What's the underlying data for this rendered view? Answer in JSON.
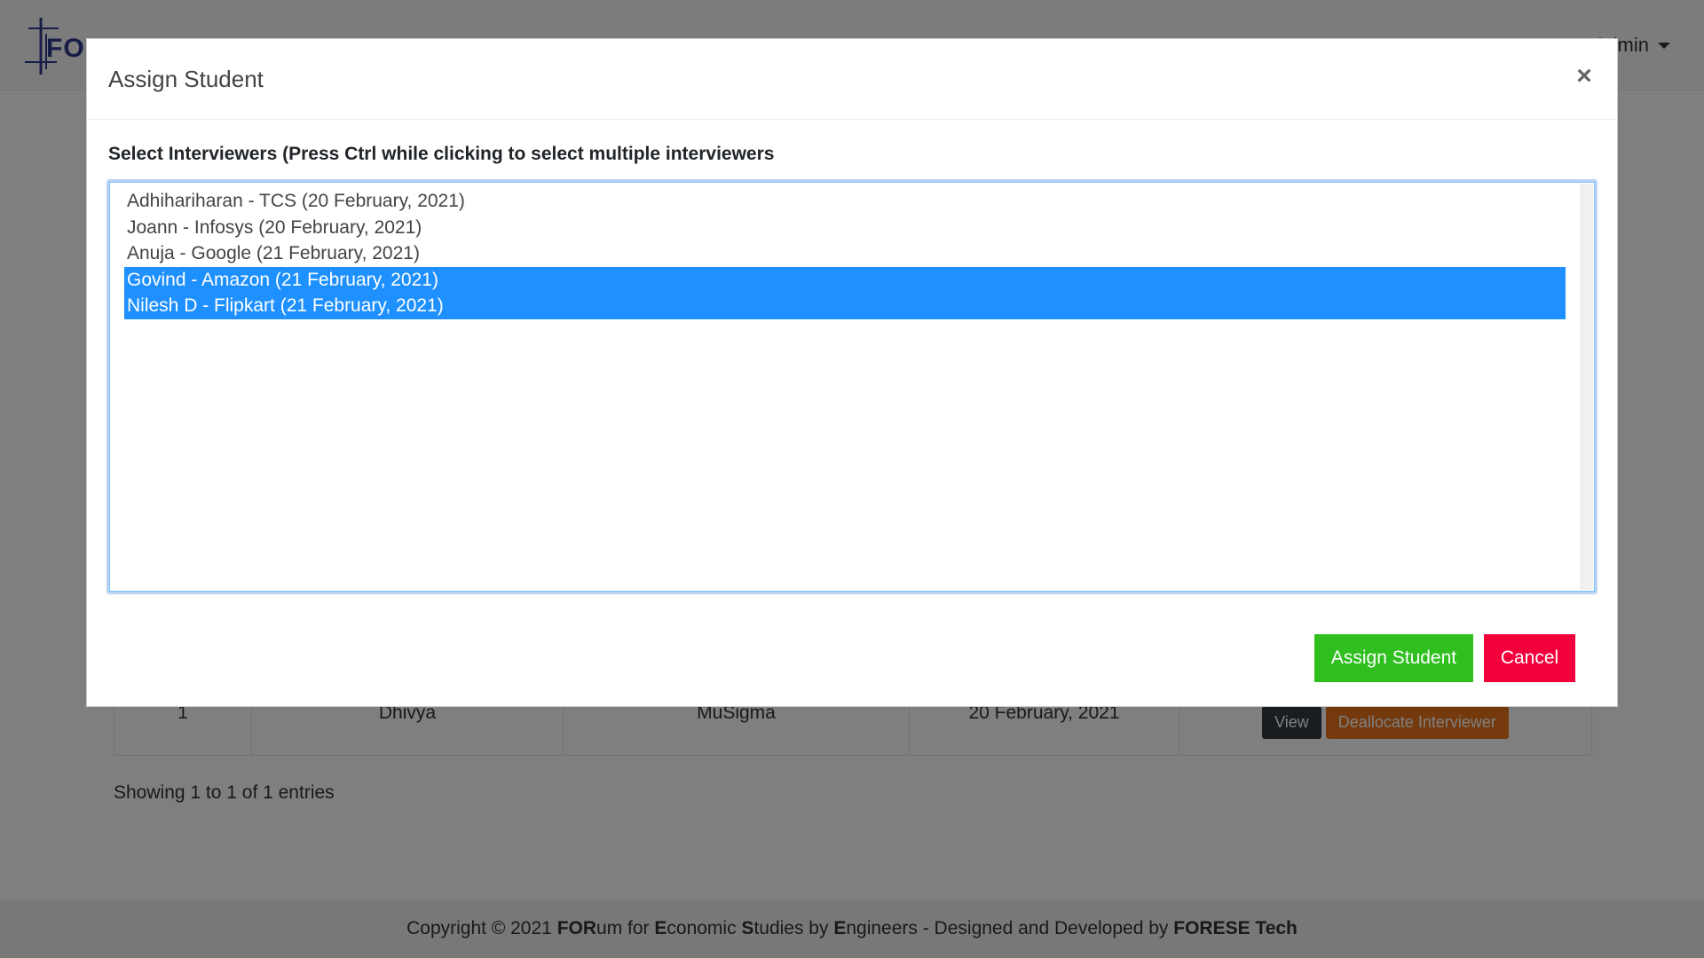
{
  "navbar": {
    "logo_text": "FORESE",
    "user_menu_label": "Admin"
  },
  "table": {
    "rows": [
      {
        "index": "1",
        "student": "Dhivya",
        "company": "MuSigma",
        "date": "20 February, 2021",
        "view_label": "View",
        "deallocate_label": "Deallocate Interviewer"
      }
    ],
    "showing_text": "Showing 1 to 1 of 1 entries"
  },
  "footer": {
    "prefix": "Copyright © 2021 ",
    "p1_bold": "FOR",
    "p1": "um for ",
    "p2_bold": "E",
    "p2": "conomic ",
    "p3_bold": "S",
    "p3": "tudies by ",
    "p4_bold": "E",
    "p4": "ngineers - Designed and Developed by ",
    "brand": "FORESE Tech"
  },
  "modal": {
    "title": "Assign Student",
    "close_symbol": "×",
    "field_label": "Select Interviewers (Press Ctrl while clicking to select multiple interviewers",
    "options": [
      {
        "label": "Adhihariharan - TCS (20 February, 2021)",
        "selected": false
      },
      {
        "label": "Joann - Infosys (20 February, 2021)",
        "selected": false
      },
      {
        "label": "Anuja - Google (21 February, 2021)",
        "selected": false
      },
      {
        "label": "Govind - Amazon (21 February, 2021)",
        "selected": true
      },
      {
        "label": "Nilesh D - Flipkart (21 February, 2021)",
        "selected": true
      }
    ],
    "assign_label": "Assign Student",
    "cancel_label": "Cancel"
  },
  "colors": {
    "selected_bg": "#1e90ff",
    "assign_bg": "#2fbf1f",
    "cancel_bg": "#f2003c",
    "deallocate_bg": "#e8741c",
    "view_bg": "#343a40"
  }
}
